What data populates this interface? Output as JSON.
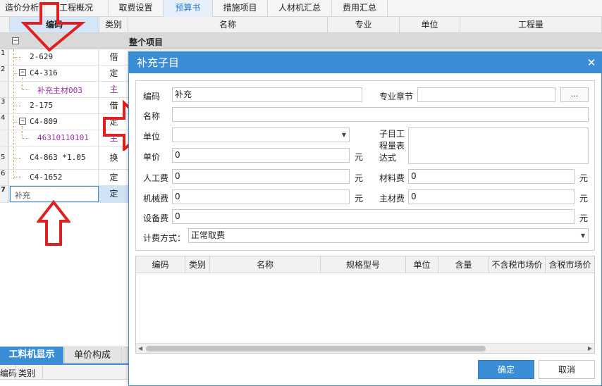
{
  "tabs": [
    "造价分析",
    "工程概况",
    "取费设置",
    "预算书",
    "措施项目",
    "人材机汇总",
    "费用汇总"
  ],
  "grid": {
    "headers": {
      "code": "编码",
      "category": "类别",
      "name": "名称",
      "specialty": "专业",
      "unit": "单位",
      "quantity": "工程量"
    },
    "group_label": "整个项目",
    "group_expander": "−",
    "rows": [
      {
        "num": "1",
        "code": "2-629",
        "category": "借",
        "expander": ""
      },
      {
        "num": "2",
        "code": "C4-316",
        "category": "定",
        "expander": "−"
      },
      {
        "num": "",
        "code": "补充主材003",
        "category": "主",
        "expander": ""
      },
      {
        "num": "3",
        "code": "2-175",
        "category": "借",
        "expander": ""
      },
      {
        "num": "4",
        "code": "C4-809",
        "category": "定",
        "expander": "−"
      },
      {
        "num": "",
        "code": "46310110101",
        "category": "主",
        "expander": ""
      },
      {
        "num": "5",
        "code": "C4-863 *1.05",
        "category": "换",
        "expander": ""
      },
      {
        "num": "6",
        "code": "C4-1652",
        "category": "定",
        "expander": ""
      },
      {
        "num": "7",
        "code": "补充",
        "category": "定",
        "expander": ""
      }
    ]
  },
  "bottom_tabs": {
    "labor": "工料机显示",
    "unit_price": "单价构成"
  },
  "bottom_headers": {
    "code": "编码",
    "category": "类别"
  },
  "dialog": {
    "title": "补充子目",
    "close": "✕",
    "code_label": "编码",
    "code_value": "补充",
    "chapter_label": "专业章节",
    "chapter_value": "",
    "browse_btn": "...",
    "name_label": "名称",
    "name_value": "",
    "unit_label": "单位",
    "unit_value": "",
    "formula_label": "子目工程量表达式",
    "formula_value": "",
    "price_label": "单价",
    "price_value": "0",
    "labor_label": "人工费",
    "labor_value": "0",
    "material_label": "材料费",
    "material_value": "0",
    "machine_label": "机械费",
    "machine_value": "0",
    "main_material_label": "主材费",
    "main_material_value": "0",
    "equipment_label": "设备费",
    "equipment_value": "0",
    "yuan": "元",
    "fee_method_label": "计费方式：",
    "fee_method_value": "正常取费",
    "subgrid_headers": [
      "编码",
      "类别",
      "名称",
      "规格型号",
      "单位",
      "含量",
      "不含税市场价",
      "含税市场价"
    ],
    "ok": "确定",
    "cancel": "取消"
  },
  "colors": {
    "accent": "#3b8ed6",
    "arrow": "#e02020",
    "purple_text": "#9b2ea5"
  }
}
